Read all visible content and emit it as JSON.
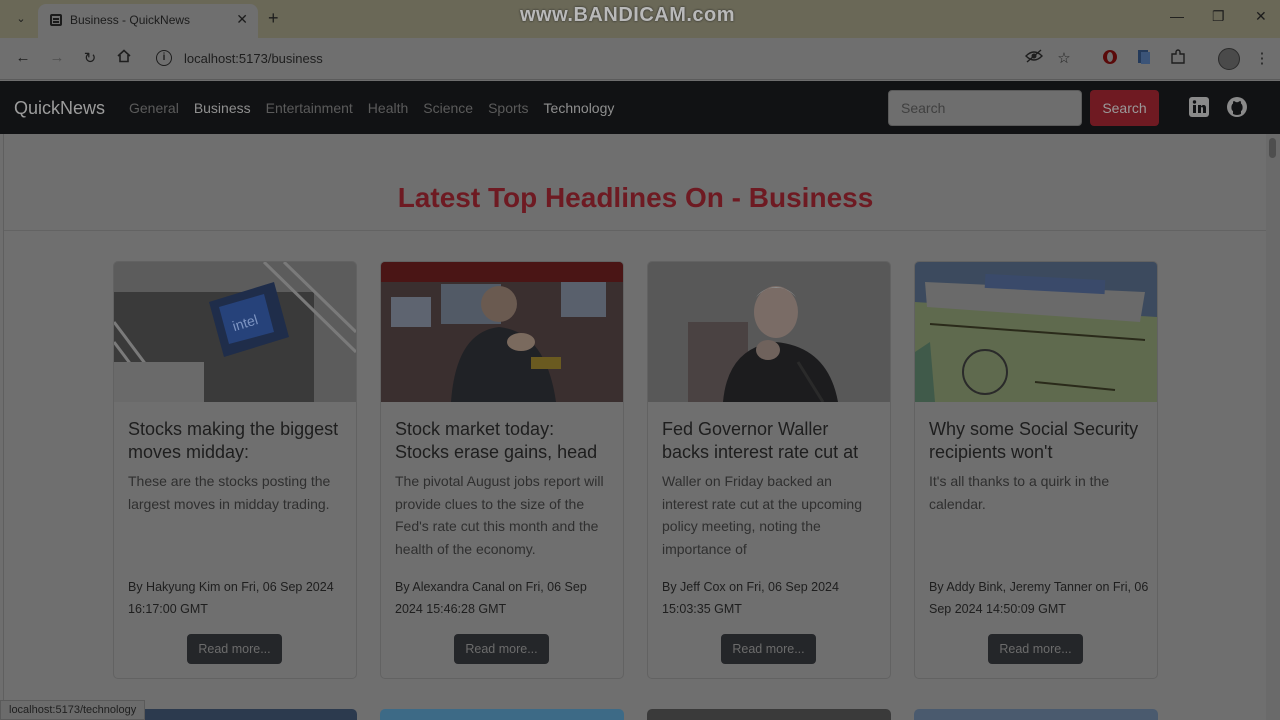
{
  "browser": {
    "tab_title": "Business - QuickNews",
    "url": "localhost:5173/business",
    "watermark": "www.BANDICAM.com",
    "status_url": "localhost:5173/technology"
  },
  "navbar": {
    "brand": "QuickNews",
    "links": [
      "General",
      "Business",
      "Entertainment",
      "Health",
      "Science",
      "Sports",
      "Technology"
    ],
    "search_placeholder": "Search",
    "search_button": "Search"
  },
  "main": {
    "headline": "Latest Top Headlines On - Business",
    "read_more": "Read more...",
    "cards": [
      {
        "title": "Stocks making the biggest moves midday:",
        "description": "These are the stocks posting the largest moves in midday trading.",
        "meta": "By Hakyung Kim on Fri, 06 Sep 2024 16:17:00 GMT"
      },
      {
        "title": "Stock market today: Stocks erase gains, head",
        "description": "The pivotal August jobs report will provide clues to the size of the Fed's rate cut this month and the health of the economy.",
        "meta": "By Alexandra Canal on Fri, 06 Sep 2024 15:46:28 GMT"
      },
      {
        "title": "Fed Governor Waller backs interest rate cut at",
        "description": "Waller on Friday backed an interest rate cut at the upcoming policy meeting, noting the importance of",
        "meta": "By Jeff Cox on Fri, 06 Sep 2024 15:03:35 GMT"
      },
      {
        "title": "Why some Social Security recipients won't",
        "description": "It's all thanks to a quirk in the calendar.",
        "meta": "By Addy Bink, Jeremy Tanner on Fri, 06 Sep 2024 14:50:09 GMT"
      }
    ]
  },
  "colors": {
    "accent_red": "#6e1a22",
    "navbar_bg": "#111214"
  }
}
